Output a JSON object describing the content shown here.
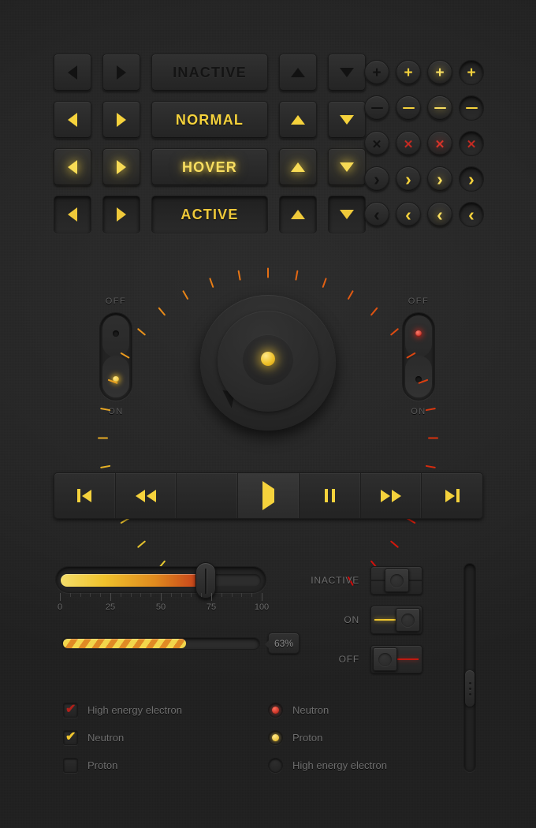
{
  "theme": {
    "background": "#272727",
    "accent_yellow": "#F5D23C",
    "accent_red": "#C22A22",
    "accent_orange": "#E08A1E",
    "text_muted": "#6e6e6e"
  },
  "button_rows": [
    {
      "state": "inactive",
      "label": "INACTIVE",
      "arrow_class": "c-inactive",
      "label_class": "lbl-inactive",
      "pressed": false
    },
    {
      "state": "normal",
      "label": "NORMAL",
      "arrow_class": "c-normal",
      "label_class": "lbl-normal",
      "pressed": false
    },
    {
      "state": "hover",
      "label": "HOVER",
      "arrow_class": "c-hover",
      "label_class": "lbl-hover",
      "pressed": false
    },
    {
      "state": "active",
      "label": "ACTIVE",
      "arrow_class": "c-active",
      "label_class": "lbl-active",
      "pressed": true
    }
  ],
  "circle_buttons": {
    "rows": [
      {
        "icon": "plus-icon",
        "glyph": "g-plus",
        "states": [
          "k-dark",
          "k-yel",
          "k-yel-glow",
          "k-yel"
        ]
      },
      {
        "icon": "minus-icon",
        "glyph": "g-minus",
        "states": [
          "k-dark",
          "k-yel",
          "k-yel-glow",
          "k-yel"
        ]
      },
      {
        "icon": "close-icon",
        "glyph": "g-x",
        "states": [
          "k-dark",
          "k-red",
          "k-red-glow",
          "k-red"
        ]
      },
      {
        "icon": "chevron-right-icon",
        "glyph": "g-r",
        "states": [
          "k-dark",
          "k-yel",
          "k-yel-glow",
          "k-yel"
        ]
      },
      {
        "icon": "chevron-left-icon",
        "glyph": "g-l",
        "states": [
          "k-dark",
          "k-yel",
          "k-yel-glow",
          "k-yel"
        ]
      }
    ],
    "column_states": [
      "inactive",
      "normal",
      "hover",
      "active"
    ]
  },
  "rockers": [
    {
      "name": "left-rocker",
      "top_label": "OFF",
      "bottom_label": "ON",
      "position": "on",
      "led_color": "yellow"
    },
    {
      "name": "right-rocker",
      "top_label": "OFF",
      "bottom_label": "ON",
      "position": "off",
      "led_color": "red"
    }
  ],
  "knob": {
    "tick_count": 31,
    "pointer_angle_deg": -133,
    "tick_colors_from": "#F2D64B",
    "tick_colors_to": "#C2240F"
  },
  "media_buttons": [
    {
      "name": "skip-back-button",
      "icon": "skip-back-icon",
      "highlight": false
    },
    {
      "name": "rewind-button",
      "icon": "rewind-icon",
      "highlight": false
    },
    {
      "name": "stop-button",
      "icon": "stop-icon",
      "highlight": false
    },
    {
      "name": "play-button",
      "icon": "play-icon",
      "highlight": true
    },
    {
      "name": "pause-button",
      "icon": "pause-icon",
      "highlight": false
    },
    {
      "name": "fast-forward-button",
      "icon": "fast-forward-icon",
      "highlight": false
    },
    {
      "name": "skip-forward-button",
      "icon": "skip-forward-icon",
      "highlight": false
    }
  ],
  "slider": {
    "value": 72,
    "min": 0,
    "max": 100,
    "tick_labels": [
      "0",
      "25",
      "50",
      "75",
      "100"
    ],
    "tick_values": [
      0,
      25,
      50,
      75,
      100
    ],
    "minor_ticks_per_major": 5
  },
  "progress": {
    "value": 63,
    "badge_label": "63%"
  },
  "switches": [
    {
      "label": "INACTIVE",
      "state": "inactive",
      "line_color": "#1c1c1c",
      "knob_side": "center"
    },
    {
      "label": "ON",
      "state": "on",
      "line_color": "#F0C62E",
      "knob_side": "right"
    },
    {
      "label": "OFF",
      "state": "off",
      "line_color": "#C01A10",
      "knob_side": "left"
    }
  ],
  "checkboxes": [
    {
      "label": "High energy electron",
      "checked": true,
      "mark": "✔",
      "color": "#B0201A"
    },
    {
      "label": "Neutron",
      "checked": true,
      "mark": "✔",
      "color": "#F0C62E"
    },
    {
      "label": "Proton",
      "checked": false,
      "mark": "",
      "color": ""
    }
  ],
  "radios": [
    {
      "label": "Neutron",
      "selected": true,
      "dot_class": "dot-r"
    },
    {
      "label": "Proton",
      "selected": true,
      "dot_class": "dot-y"
    },
    {
      "label": "High energy electron",
      "selected": false,
      "dot_class": ""
    }
  ],
  "scrollbar": {
    "orientation": "vertical",
    "thumb_position_percent": 62,
    "grip_dots": 3
  }
}
